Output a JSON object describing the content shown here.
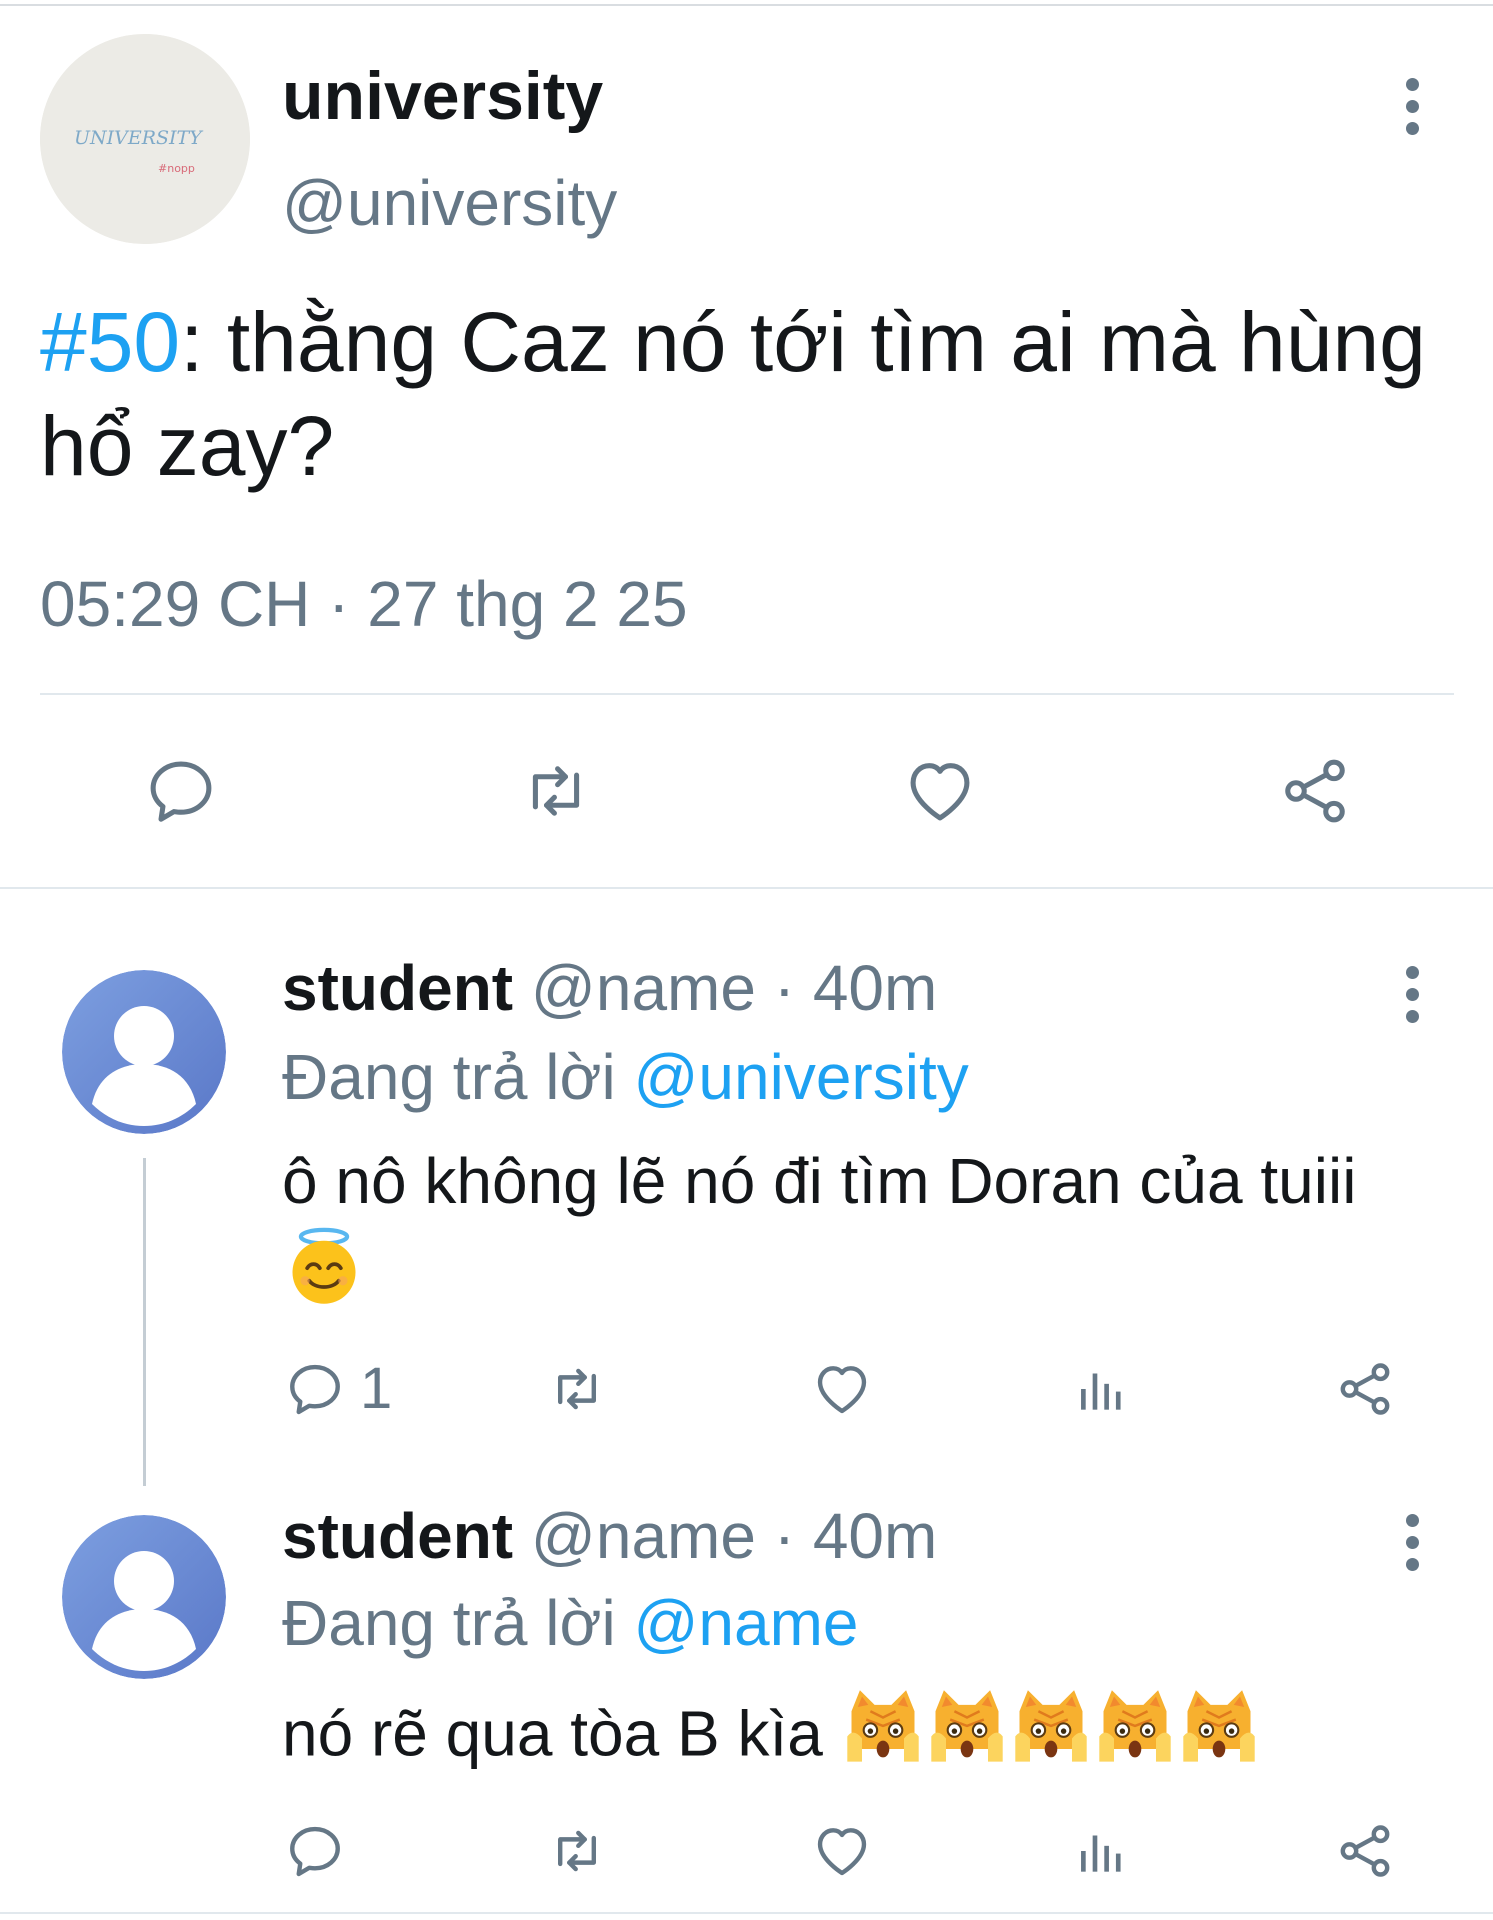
{
  "main_tweet": {
    "display_name": "university",
    "handle": "@university",
    "avatar_text": "UNIVERSITY",
    "avatar_subtext": "#nopp",
    "hashtag": "#50",
    "text": ": thằng Caz nó tới tìm ai mà hùng hổ zay?",
    "timestamp": "05:29 CH · 27 thg 2 25",
    "icons": [
      "reply-icon",
      "retweet-icon",
      "like-icon",
      "share-icon",
      "more-icon"
    ]
  },
  "replies": [
    {
      "display_name": "student",
      "meta": " @name · 40m",
      "replying_label": "Đang trả lời ",
      "replying_to": "@university",
      "text": "ô nô không lẽ nó đi tìm Doran của tuiii",
      "emoji": "smiling-face-with-halo",
      "reply_count": "1"
    },
    {
      "display_name": "student",
      "meta": " @name · 40m",
      "replying_label": "Đang trả lời ",
      "replying_to": "@name",
      "text": "nó rẽ qua tòa B kìa",
      "emoji": "weary-cat-face x5"
    }
  ],
  "colors": {
    "accent": "#1da1f2",
    "muted": "#657786",
    "text": "#14171a",
    "divider": "#e1e8ed"
  }
}
